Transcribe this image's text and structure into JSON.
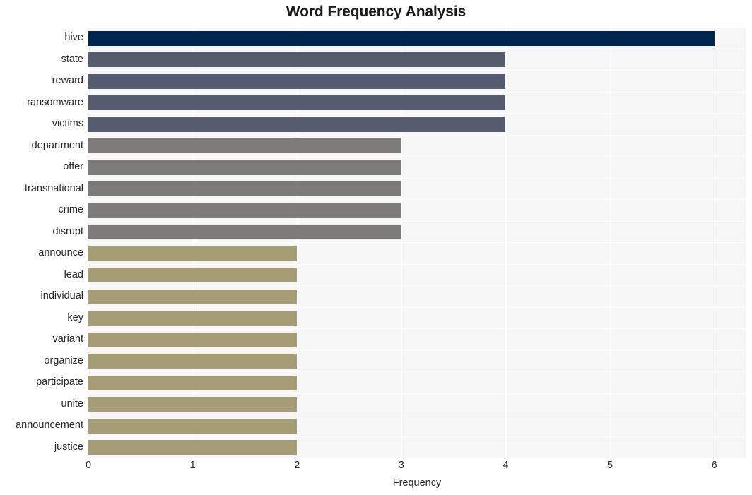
{
  "chart_data": {
    "type": "bar",
    "orientation": "horizontal",
    "title": "Word Frequency Analysis",
    "xlabel": "Frequency",
    "ylabel": "",
    "xlim": [
      0,
      6.3
    ],
    "xticks": [
      "0",
      "1",
      "2",
      "3",
      "4",
      "5",
      "6"
    ],
    "xtick_values": [
      0,
      1,
      2,
      3,
      4,
      5,
      6
    ],
    "grid": true,
    "legend": "none",
    "categories": [
      "hive",
      "state",
      "reward",
      "ransomware",
      "victims",
      "department",
      "offer",
      "transnational",
      "crime",
      "disrupt",
      "announce",
      "lead",
      "individual",
      "key",
      "variant",
      "organize",
      "participate",
      "unite",
      "announcement",
      "justice"
    ],
    "values": [
      6,
      4,
      4,
      4,
      4,
      3,
      3,
      3,
      3,
      3,
      2,
      2,
      2,
      2,
      2,
      2,
      2,
      2,
      2,
      2
    ],
    "bar_colors": [
      "#00254f",
      "#565c70",
      "#565c70",
      "#565c70",
      "#565c70",
      "#7c7b78",
      "#7c7b78",
      "#7c7b78",
      "#7c7b78",
      "#7c7b78",
      "#a49d76",
      "#a49d76",
      "#a49d76",
      "#a49d76",
      "#a49d76",
      "#a49d76",
      "#a49d76",
      "#a49d76",
      "#a49d76",
      "#a49d76"
    ],
    "plot_background": "#f6f6f7",
    "grid_color": "#ffffff",
    "figure_background": "#ffffff",
    "text_color": "#262626"
  }
}
